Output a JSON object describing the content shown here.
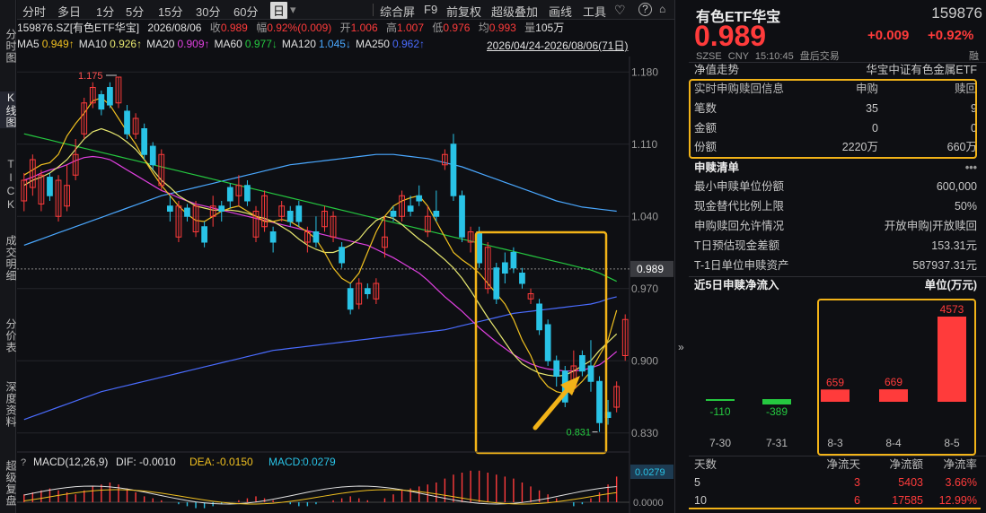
{
  "sidebar": [
    "分时图",
    "K线图",
    "TICK",
    "成交明细",
    "分价表",
    "深度资料",
    "超级复盘"
  ],
  "topbar": {
    "left": [
      "分时",
      "多日",
      "1分",
      "5分",
      "15分",
      "30分",
      "60分",
      "日"
    ],
    "right": [
      "综合屏",
      "F9",
      "前复权",
      "超级叠加",
      "画线",
      "工具"
    ],
    "icons": [
      "heart-icon",
      "help-icon",
      "lock-icon"
    ]
  },
  "info1": {
    "code_name": "159876.SZ[有色ETF华宝]",
    "date": "2026/08/06",
    "close_label": "收",
    "close": "0.989",
    "chg_label": "幅",
    "chg": "0.92%(0.009)",
    "open_label": "开",
    "open": "1.006",
    "high_label": "高",
    "high": "1.007",
    "low_label": "低",
    "low": "0.976",
    "avg_label": "均",
    "avg": "0.993",
    "vol_label": "量",
    "vol": "105万"
  },
  "ma": [
    {
      "name": "MA5",
      "value": "0.949↑",
      "color": "#f0c020"
    },
    {
      "name": "MA10",
      "value": "0.926↑",
      "color": "#e8e870"
    },
    {
      "name": "MA20",
      "value": "0.909↑",
      "color": "#e040e0"
    },
    {
      "name": "MA60",
      "value": "0.977↓",
      "color": "#25c840"
    },
    {
      "name": "MA120",
      "value": "1.045↓",
      "color": "#4aa8ff"
    },
    {
      "name": "MA250",
      "value": "0.962↑",
      "color": "#4a6cff"
    }
  ],
  "range_label": "2026/04/24-2026/08/06(71日)",
  "chart_data": {
    "type": "candlestick",
    "ylim": [
      0.815,
      1.195
    ],
    "y_ticks": [
      "1.180",
      "1.110",
      "1.040",
      "0.970",
      "0.900",
      "0.830"
    ],
    "current_price": "0.989",
    "annot_high": "1.175",
    "annot_low": "0.831",
    "candles": [
      [
        1.055,
        1.075,
        1.045,
        1.082
      ],
      [
        1.068,
        1.095,
        1.06,
        1.1
      ],
      [
        1.052,
        1.08,
        1.045,
        1.085
      ],
      [
        1.078,
        1.06,
        1.055,
        1.082
      ],
      [
        1.04,
        1.075,
        1.035,
        1.08
      ],
      [
        1.05,
        1.07,
        1.045,
        1.09
      ],
      [
        1.08,
        1.1,
        1.075,
        1.115
      ],
      [
        1.12,
        1.15,
        1.115,
        1.155
      ],
      [
        1.15,
        1.165,
        1.145,
        1.17
      ],
      [
        1.158,
        1.144,
        1.138,
        1.162
      ],
      [
        1.165,
        1.148,
        1.145,
        1.17
      ],
      [
        1.15,
        1.175,
        1.145,
        1.175
      ],
      [
        1.142,
        1.12,
        1.115,
        1.148
      ],
      [
        1.12,
        1.135,
        1.115,
        1.14
      ],
      [
        1.125,
        1.1,
        1.095,
        1.13
      ],
      [
        1.108,
        1.09,
        1.085,
        1.112
      ],
      [
        1.07,
        1.1,
        1.065,
        1.105
      ],
      [
        1.05,
        1.045,
        1.035,
        1.06
      ],
      [
        1.02,
        1.05,
        1.015,
        1.055
      ],
      [
        1.048,
        1.04,
        1.035,
        1.052
      ],
      [
        1.025,
        1.05,
        1.02,
        1.055
      ],
      [
        1.03,
        1.015,
        1.01,
        1.035
      ],
      [
        1.04,
        1.05,
        1.03,
        1.06
      ],
      [
        1.05,
        1.045,
        1.035,
        1.055
      ],
      [
        1.068,
        1.055,
        1.048,
        1.072
      ],
      [
        1.06,
        1.07,
        1.05,
        1.08
      ],
      [
        1.07,
        1.055,
        1.05,
        1.075
      ],
      [
        1.02,
        1.045,
        1.015,
        1.05
      ],
      [
        1.03,
        1.06,
        1.025,
        1.065
      ],
      [
        1.025,
        1.015,
        1.005,
        1.03
      ],
      [
        1.04,
        1.05,
        1.035,
        1.055
      ],
      [
        1.045,
        1.035,
        1.03,
        1.05
      ],
      [
        1.05,
        1.035,
        1.03,
        1.055
      ],
      [
        1.015,
        1.025,
        1.005,
        1.03
      ],
      [
        1.025,
        1.015,
        1.01,
        1.04
      ],
      [
        1.03,
        1.045,
        1.025,
        1.05
      ],
      [
        1.02,
        1.04,
        1.015,
        1.045
      ],
      [
        1.01,
        0.995,
        0.99,
        1.015
      ],
      [
        0.97,
        0.95,
        0.945,
        0.975
      ],
      [
        0.955,
        0.975,
        0.95,
        0.98
      ],
      [
        0.97,
        0.965,
        0.96,
        0.975
      ],
      [
        0.96,
        0.975,
        0.955,
        0.98
      ],
      [
        1.01,
        1.02,
        1.0,
        1.04
      ],
      [
        1.045,
        1.04,
        1.035,
        1.05
      ],
      [
        1.04,
        1.06,
        1.035,
        1.065
      ],
      [
        1.05,
        1.045,
        1.04,
        1.06
      ],
      [
        1.06,
        1.055,
        1.05,
        1.07
      ],
      [
        1.025,
        1.04,
        1.02,
        1.05
      ],
      [
        1.045,
        1.04,
        1.035,
        1.065
      ],
      [
        1.09,
        1.1,
        1.085,
        1.105
      ],
      [
        1.11,
        1.06,
        1.055,
        1.12
      ],
      [
        1.06,
        1.02,
        1.015,
        1.065
      ],
      [
        1.015,
        1.025,
        1.005,
        1.03
      ],
      [
        1.025,
        0.995,
        0.99,
        1.03
      ],
      [
        0.97,
        1.01,
        0.965,
        1.015
      ],
      [
        0.99,
        0.96,
        0.955,
        0.995
      ],
      [
        0.995,
        0.985,
        0.975,
        1.005
      ],
      [
        1.005,
        0.99,
        0.985,
        1.01
      ],
      [
        0.985,
        0.975,
        0.97,
        0.99
      ],
      [
        0.96,
        0.965,
        0.955,
        0.97
      ],
      [
        0.955,
        0.93,
        0.925,
        0.96
      ],
      [
        0.935,
        0.9,
        0.895,
        0.94
      ],
      [
        0.9,
        0.885,
        0.875,
        0.905
      ],
      [
        0.89,
        0.86,
        0.855,
        0.895
      ],
      [
        0.875,
        0.895,
        0.87,
        0.91
      ],
      [
        0.905,
        0.89,
        0.885,
        0.91
      ],
      [
        0.895,
        0.88,
        0.87,
        0.92
      ],
      [
        0.88,
        0.84,
        0.831,
        0.885
      ],
      [
        0.85,
        0.845,
        0.838,
        0.862
      ],
      [
        0.855,
        0.875,
        0.85,
        0.88
      ],
      [
        0.905,
        0.94,
        0.9,
        0.945
      ]
    ],
    "ma5": [
      1.08,
      1.085,
      1.09,
      1.092,
      1.1,
      1.118,
      1.13,
      1.14,
      1.152,
      1.155,
      1.148,
      1.135,
      1.122,
      1.11,
      1.095,
      1.082,
      1.07,
      1.06,
      1.05,
      1.042,
      1.036,
      1.035,
      1.04,
      1.045,
      1.048,
      1.05,
      1.045,
      1.04,
      1.035,
      1.035,
      1.037,
      1.035,
      1.03,
      1.025,
      1.018,
      1.005,
      0.99,
      0.98,
      0.975,
      0.985,
      1.005,
      1.025,
      1.04,
      1.05,
      1.055,
      1.058,
      1.06,
      1.05,
      1.035,
      1.02,
      1.005,
      0.998,
      0.992,
      0.985,
      0.975,
      0.965,
      0.955,
      0.94,
      0.92,
      0.905,
      0.885,
      0.875,
      0.87,
      0.868,
      0.872,
      0.88,
      0.89,
      0.905,
      0.92,
      0.949
    ],
    "ma10": [
      1.07,
      1.075,
      1.078,
      1.082,
      1.088,
      1.095,
      1.105,
      1.115,
      1.122,
      1.125,
      1.122,
      1.118,
      1.112,
      1.105,
      1.095,
      1.085,
      1.075,
      1.068,
      1.06,
      1.055,
      1.05,
      1.048,
      1.046,
      1.046,
      1.046,
      1.045,
      1.043,
      1.04,
      1.038,
      1.035,
      1.03,
      1.025,
      1.018,
      1.012,
      1.008,
      1.005,
      1.005,
      1.008,
      1.012,
      1.018,
      1.028,
      1.036,
      1.04,
      1.038,
      1.032,
      1.025,
      1.018,
      1.012,
      1.005,
      0.998,
      0.99,
      0.98,
      0.968,
      0.955,
      0.942,
      0.93,
      0.918,
      0.906,
      0.897,
      0.892,
      0.888,
      0.886,
      0.885,
      0.886,
      0.89,
      0.895,
      0.9,
      0.91,
      0.918,
      0.926
    ],
    "ma20": [
      1.075,
      1.078,
      1.082,
      1.085,
      1.087,
      1.09,
      1.094,
      1.097,
      1.098,
      1.097,
      1.095,
      1.09,
      1.085,
      1.08,
      1.075,
      1.07,
      1.065,
      1.062,
      1.058,
      1.055,
      1.052,
      1.05,
      1.048,
      1.046,
      1.044,
      1.042,
      1.04,
      1.038,
      1.036,
      1.034,
      1.032,
      1.03,
      1.028,
      1.026,
      1.024,
      1.022,
      1.02,
      1.018,
      1.016,
      1.014,
      1.012,
      1.008,
      1.004,
      1.0,
      0.995,
      0.99,
      0.985,
      0.978,
      0.97,
      0.962,
      0.955,
      0.948,
      0.94,
      0.932,
      0.925,
      0.918,
      0.912,
      0.906,
      0.901,
      0.897,
      0.894,
      0.892,
      0.891,
      0.89,
      0.89,
      0.891,
      0.893,
      0.896,
      0.902,
      0.909
    ],
    "ma60": [
      1.12,
      1.118,
      1.116,
      1.114,
      1.112,
      1.11,
      1.108,
      1.106,
      1.104,
      1.102,
      1.1,
      1.098,
      1.096,
      1.094,
      1.092,
      1.09,
      1.088,
      1.086,
      1.084,
      1.082,
      1.08,
      1.078,
      1.076,
      1.074,
      1.072,
      1.07,
      1.068,
      1.066,
      1.064,
      1.062,
      1.06,
      1.058,
      1.056,
      1.054,
      1.052,
      1.05,
      1.048,
      1.046,
      1.044,
      1.042,
      1.04,
      1.038,
      1.036,
      1.034,
      1.032,
      1.03,
      1.028,
      1.026,
      1.024,
      1.022,
      1.02,
      1.018,
      1.016,
      1.014,
      1.012,
      1.01,
      1.008,
      1.006,
      1.004,
      1.002,
      1.0,
      0.998,
      0.996,
      0.994,
      0.992,
      0.99,
      0.988,
      0.985,
      0.981,
      0.977
    ],
    "ma120": [
      1.012,
      1.015,
      1.018,
      1.021,
      1.024,
      1.027,
      1.03,
      1.033,
      1.036,
      1.039,
      1.042,
      1.045,
      1.048,
      1.051,
      1.054,
      1.057,
      1.06,
      1.062,
      1.064,
      1.066,
      1.068,
      1.07,
      1.072,
      1.074,
      1.076,
      1.078,
      1.08,
      1.082,
      1.084,
      1.086,
      1.088,
      1.09,
      1.091,
      1.092,
      1.093,
      1.094,
      1.095,
      1.096,
      1.097,
      1.098,
      1.099,
      1.1,
      1.1,
      1.1,
      1.099,
      1.098,
      1.097,
      1.096,
      1.094,
      1.092,
      1.09,
      1.088,
      1.085,
      1.082,
      1.079,
      1.076,
      1.073,
      1.07,
      1.067,
      1.064,
      1.061,
      1.058,
      1.055,
      1.053,
      1.051,
      1.049,
      1.048,
      1.047,
      1.046,
      1.045
    ],
    "ma250": [
      0.843,
      0.846,
      0.849,
      0.852,
      0.855,
      0.858,
      0.861,
      0.864,
      0.867,
      0.87,
      0.872,
      0.874,
      0.876,
      0.878,
      0.88,
      0.882,
      0.884,
      0.886,
      0.888,
      0.89,
      0.892,
      0.894,
      0.896,
      0.898,
      0.9,
      0.902,
      0.904,
      0.906,
      0.908,
      0.91,
      0.911,
      0.912,
      0.913,
      0.914,
      0.915,
      0.916,
      0.917,
      0.918,
      0.919,
      0.92,
      0.921,
      0.922,
      0.923,
      0.924,
      0.925,
      0.926,
      0.927,
      0.928,
      0.929,
      0.93,
      0.932,
      0.934,
      0.936,
      0.938,
      0.94,
      0.942,
      0.944,
      0.946,
      0.947,
      0.948,
      0.949,
      0.95,
      0.951,
      0.952,
      0.953,
      0.954,
      0.955,
      0.957,
      0.96,
      0.962
    ],
    "macd": {
      "label": "MACD(12,26,9)",
      "dif_label": "DIF:",
      "dif": "-0.0010",
      "dea_label": "DEA:",
      "dea": "-0.0150",
      "macd_label": "MACD:",
      "macd": "0.0279",
      "value_tag": "0.0279",
      "zero_tick": "0.0000"
    }
  },
  "right": {
    "name": "有色ETF华宝",
    "code": "159876",
    "price": "0.989",
    "change": "+0.009",
    "change_pct": "+0.92%",
    "sub": [
      "SZSE",
      "CNY",
      "15:10:45",
      "盘后交易"
    ],
    "rong": "融",
    "nav_label": "净值走势",
    "nav_name": "华宝中证有色金属ETF",
    "realtime": {
      "title": "实时申购赎回信息",
      "col1": "申购",
      "col2": "赎回",
      "rows": [
        [
          "笔数",
          "35",
          "9"
        ],
        [
          "金额",
          "0",
          "0"
        ],
        [
          "份额",
          "2220万",
          "660万"
        ]
      ]
    },
    "list_title": "申赎清单",
    "list_more": "•••",
    "list": [
      [
        "最小申赎单位份额",
        "600,000"
      ],
      [
        "现金替代比例上限",
        "50%"
      ],
      [
        "申购赎回允许情况",
        "开放申购|开放赎回"
      ],
      [
        "T日预估现金差额",
        "153.31元"
      ],
      [
        "T-1日单位申赎资产",
        "587937.31元"
      ]
    ],
    "flow_title": "近5日申赎净流入",
    "flow_unit": "单位(万元)",
    "flow": {
      "categories": [
        "7-30",
        "7-31",
        "8-3",
        "8-4",
        "8-5"
      ],
      "values": [
        -110,
        -389,
        659,
        669,
        4573
      ]
    },
    "stats": {
      "headers": [
        "天数",
        "净流天",
        "净流额",
        "净流率"
      ],
      "rows": [
        [
          "5",
          "3",
          "5403",
          "3.66%"
        ],
        [
          "10",
          "6",
          "17585",
          "12.99%"
        ]
      ]
    }
  }
}
